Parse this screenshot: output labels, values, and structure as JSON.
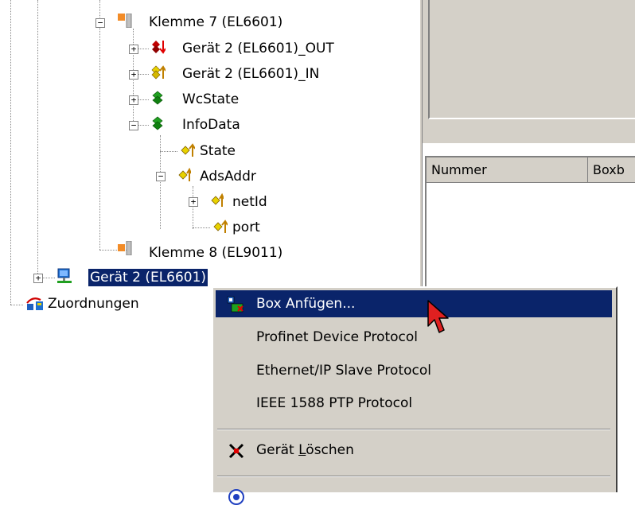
{
  "tree": {
    "klemme7": "Klemme 7 (EL6601)",
    "out": "Gerät 2 (EL6601)_OUT",
    "in": "Gerät 2 (EL6601)_IN",
    "wcstate": "WcState",
    "infodata": "InfoData",
    "state": "State",
    "adsaddr": "AdsAddr",
    "netid": "netId",
    "port": "port",
    "klemme8": "Klemme 8 (EL9011)",
    "geraet2": "Gerät 2 (EL6601)",
    "zuordnungen": "Zuordnungen"
  },
  "list": {
    "col_nummer": "Nummer",
    "col_box": "Boxb"
  },
  "menu": {
    "box_anfuegen": "Box Anfügen...",
    "profinet": "Profinet Device Protocol",
    "ethernetip": "Ethernet/IP Slave Protocol",
    "ieee1588": "IEEE 1588 PTP Protocol",
    "geraet_loeschen_pre": "Gerät ",
    "geraet_loeschen_acc": "L",
    "geraet_loeschen_post": "öschen"
  },
  "colors": {
    "selection": "#0a246a",
    "panel": "#d4d0c8"
  },
  "icons": [
    "terminal-icon",
    "output-var-icon",
    "input-var-icon",
    "status-var-icon",
    "var-icon",
    "device-icon",
    "mapping-icon",
    "add-box-icon",
    "delete-icon",
    "online-icon",
    "cursor-icon"
  ]
}
